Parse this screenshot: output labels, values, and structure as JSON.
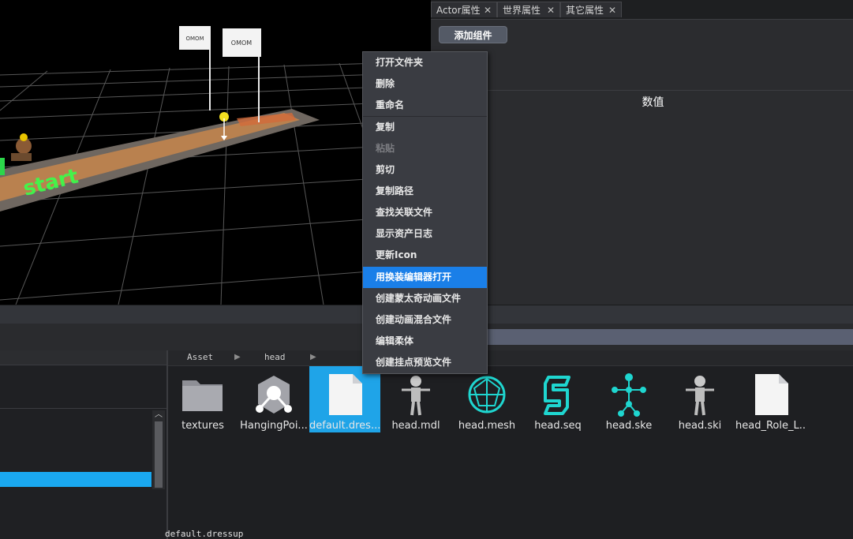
{
  "viewport": {
    "flag_text": "OMOM",
    "floor_text": "start"
  },
  "props_panel": {
    "tabs": [
      {
        "label": "Actor属性"
      },
      {
        "label": "世界属性"
      },
      {
        "label": "其它属性"
      }
    ],
    "tab_close_glyph": "✕",
    "add_component_label": "添加组件",
    "value_title": "数值"
  },
  "context_menu": {
    "items": [
      {
        "label": "打开文件夹",
        "state": "normal"
      },
      {
        "label": "删除",
        "state": "normal"
      },
      {
        "label": "重命名",
        "state": "normal"
      },
      {
        "label": "复制",
        "state": "normal"
      },
      {
        "label": "粘贴",
        "state": "disabled"
      },
      {
        "label": "剪切",
        "state": "normal"
      },
      {
        "label": "复制路径",
        "state": "normal"
      },
      {
        "label": "查找关联文件",
        "state": "normal"
      },
      {
        "label": "显示资产日志",
        "state": "normal"
      },
      {
        "label": "更新Icon",
        "state": "normal"
      },
      {
        "label": "用换装编辑器打开",
        "state": "highlighted"
      },
      {
        "label": "创建蒙太奇动画文件",
        "state": "normal"
      },
      {
        "label": "创建动画混合文件",
        "state": "normal"
      },
      {
        "label": "编辑柔体",
        "state": "normal"
      },
      {
        "label": "创建挂点预览文件",
        "state": "normal"
      }
    ]
  },
  "asset_browser": {
    "breadcrumb": [
      "Asset",
      "head"
    ],
    "breadcrumb_arrow": "▶",
    "files": [
      {
        "label": "textures",
        "icon": "folder-icon"
      },
      {
        "label": "HangingPoi...",
        "icon": "hanging-point-icon"
      },
      {
        "label": "default.dres...",
        "icon": "blank-file-icon",
        "selected": true
      },
      {
        "label": "head.mdl",
        "icon": "character-model-icon"
      },
      {
        "label": "head.mesh",
        "icon": "mesh-sphere-icon"
      },
      {
        "label": "head.seq",
        "icon": "sequence-s-icon"
      },
      {
        "label": "head.ske",
        "icon": "skeleton-icon"
      },
      {
        "label": "head.ski",
        "icon": "character-skin-icon"
      },
      {
        "label": "head_Role_L...",
        "icon": "blank-file-icon"
      }
    ],
    "status_path": "default.dressup"
  },
  "tree": {
    "scroll_up_glyph": "︿"
  },
  "colors": {
    "accent_blue": "#1aa8f0",
    "menu_highlight": "#1a7fe8",
    "teal_icon": "#1fd6d0"
  }
}
